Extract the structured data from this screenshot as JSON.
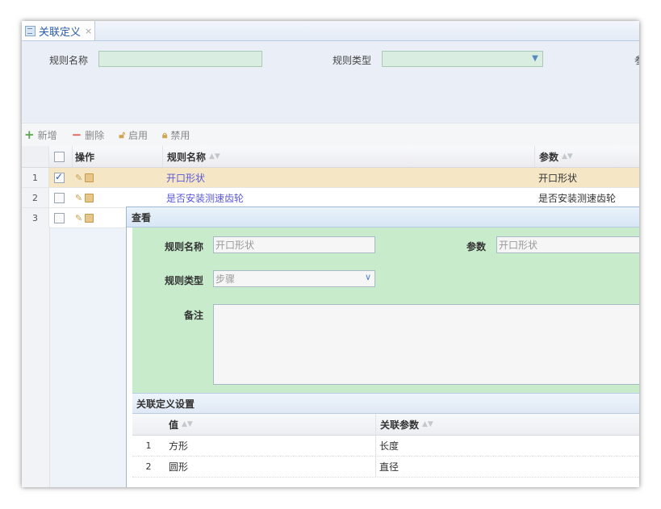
{
  "tab": {
    "title": "关联定义",
    "close": "×"
  },
  "filter": {
    "rule_name_label": "规则名称",
    "rule_type_label": "规则类型",
    "param_label_partial": "参"
  },
  "toolbar": {
    "add": "新增",
    "delete": "删除",
    "enable": "启用",
    "disable": "禁用"
  },
  "grid": {
    "headers": {
      "ops": "操作",
      "rule_name": "规则名称",
      "param": "参数"
    },
    "rows": [
      {
        "num": "1",
        "rule_name": "开口形状",
        "param": "开口形状",
        "checked": true
      },
      {
        "num": "2",
        "rule_name": "是否安装测速齿轮",
        "param": "是否安装测速齿轮",
        "checked": false
      },
      {
        "num": "3",
        "rule_name": "",
        "param": "",
        "checked": false
      }
    ]
  },
  "dialog": {
    "title": "查看",
    "rule_name_label": "规则名称",
    "rule_name_value": "开口形状",
    "param_label": "参数",
    "param_value": "开口形状",
    "rule_type_label": "规则类型",
    "rule_type_value": "步骤",
    "remark_label": "备注",
    "section_title": "关联定义设置",
    "sub_headers": {
      "value": "值",
      "related_param": "关联参数"
    },
    "sub_rows": [
      {
        "num": "1",
        "value": "方形",
        "related_param": "长度"
      },
      {
        "num": "2",
        "value": "圆形",
        "related_param": "直径"
      }
    ]
  },
  "colors": {
    "accent": "#2a5da8",
    "selected_row": "#f5e7c6",
    "form_bg": "#c8ebcc",
    "link": "#5a58d8"
  }
}
